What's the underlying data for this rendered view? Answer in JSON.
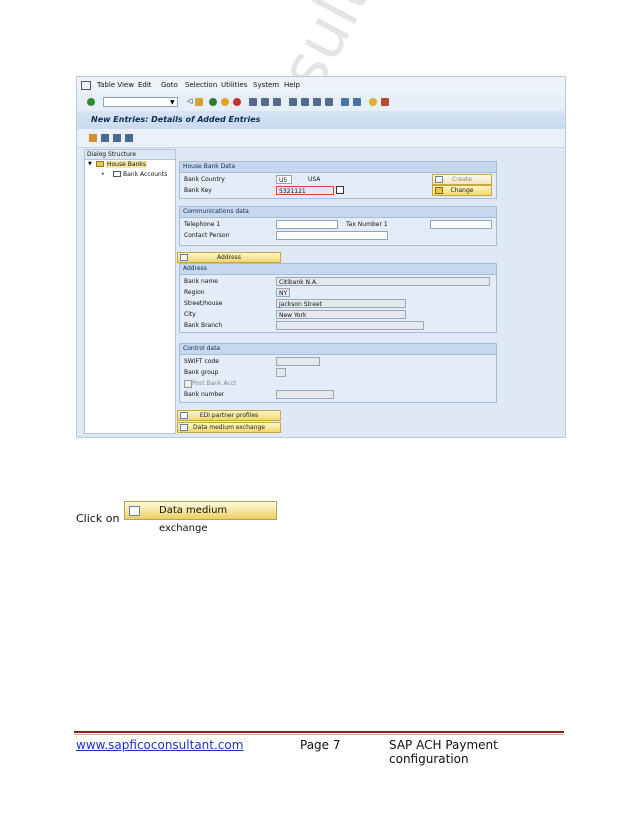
{
  "sap": {
    "menu": [
      "Table View",
      "Edit",
      "Goto",
      "Selection",
      "Utilities",
      "System",
      "Help"
    ],
    "title": "New Entries: Details of Added Entries",
    "tree": {
      "header": "Dialog Structure",
      "items": [
        "House Banks",
        "Bank Accounts"
      ]
    },
    "house_bank_data": {
      "header": "House Bank Data",
      "bank_country_label": "Bank Country",
      "bank_country_value": "US",
      "bank_country_name": "USA",
      "bank_key_label": "Bank Key",
      "bank_key_value": "5321121",
      "create_label": "Create",
      "change_label": "Change"
    },
    "communications": {
      "header": "Communications data",
      "telephone_label": "Telephone 1",
      "tax_label": "Tax Number 1",
      "contact_label": "Contact Person"
    },
    "address_button": "Address",
    "address": {
      "header": "Address",
      "bank_name_label": "Bank name",
      "bank_name_value": "Citibank N.A.",
      "region_label": "Region",
      "region_value": "NY",
      "street_label": "Street/house",
      "street_value": "Jackson Street",
      "city_label": "City",
      "city_value": "New York",
      "branch_label": "Bank Branch"
    },
    "control": {
      "header": "Control data",
      "swift_label": "SWIFT code",
      "group_label": "Bank group",
      "post_label": "Post Bank Acct",
      "number_label": "Bank number"
    },
    "edi_button": "EDI partner profiles",
    "dme_button": "Data medium exchange"
  },
  "body": {
    "click_text": "Click on",
    "button_label": "Data medium exchange",
    "watermark": "sapficoconsultant"
  },
  "footer": {
    "link": "www.sapficoconsultant.com",
    "page": "Page 7",
    "doc_title": "SAP ACH Payment configuration"
  }
}
